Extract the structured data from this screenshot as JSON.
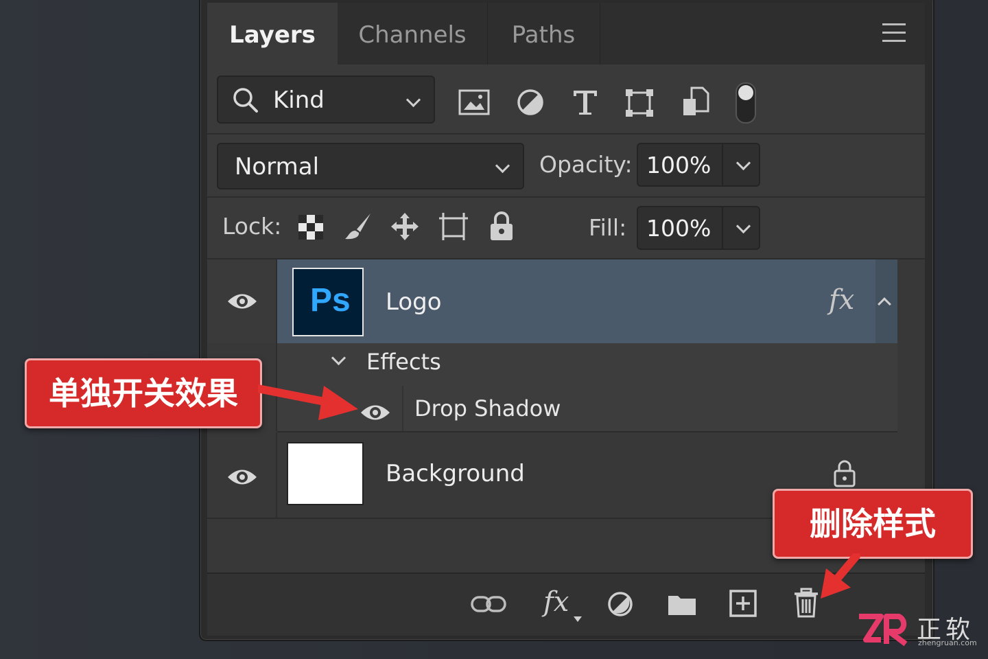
{
  "tabs": [
    "Layers",
    "Channels",
    "Paths"
  ],
  "filter": {
    "kind_label": "Kind",
    "icons": [
      "image-filter-icon",
      "adjustment-filter-icon",
      "type-filter-icon",
      "shape-filter-icon",
      "smart-object-filter-icon",
      "filter-toggle-icon"
    ]
  },
  "blend": {
    "mode": "Normal",
    "opacity_label": "Opacity:",
    "opacity_value": "100%"
  },
  "lock": {
    "label": "Lock:",
    "fill_label": "Fill:",
    "fill_value": "100%"
  },
  "layers": [
    {
      "name": "Logo",
      "thumb": "Ps",
      "fx": "fx",
      "selected": true
    },
    {
      "name": "Background",
      "locked": true
    }
  ],
  "effects": {
    "label": "Effects",
    "items": [
      "Drop Shadow"
    ]
  },
  "footer": {
    "fx_label": "fx"
  },
  "callouts": {
    "toggle_effect": "单独开关效果",
    "delete_style": "删除样式"
  },
  "brand": {
    "logo_text": "正软",
    "url": "zhengruan.com"
  },
  "colors": {
    "panel": "#3a3a3a",
    "selected_layer": "#4a5a6c",
    "callout": "#d62a2a",
    "ps_blue": "#31a8ff"
  }
}
